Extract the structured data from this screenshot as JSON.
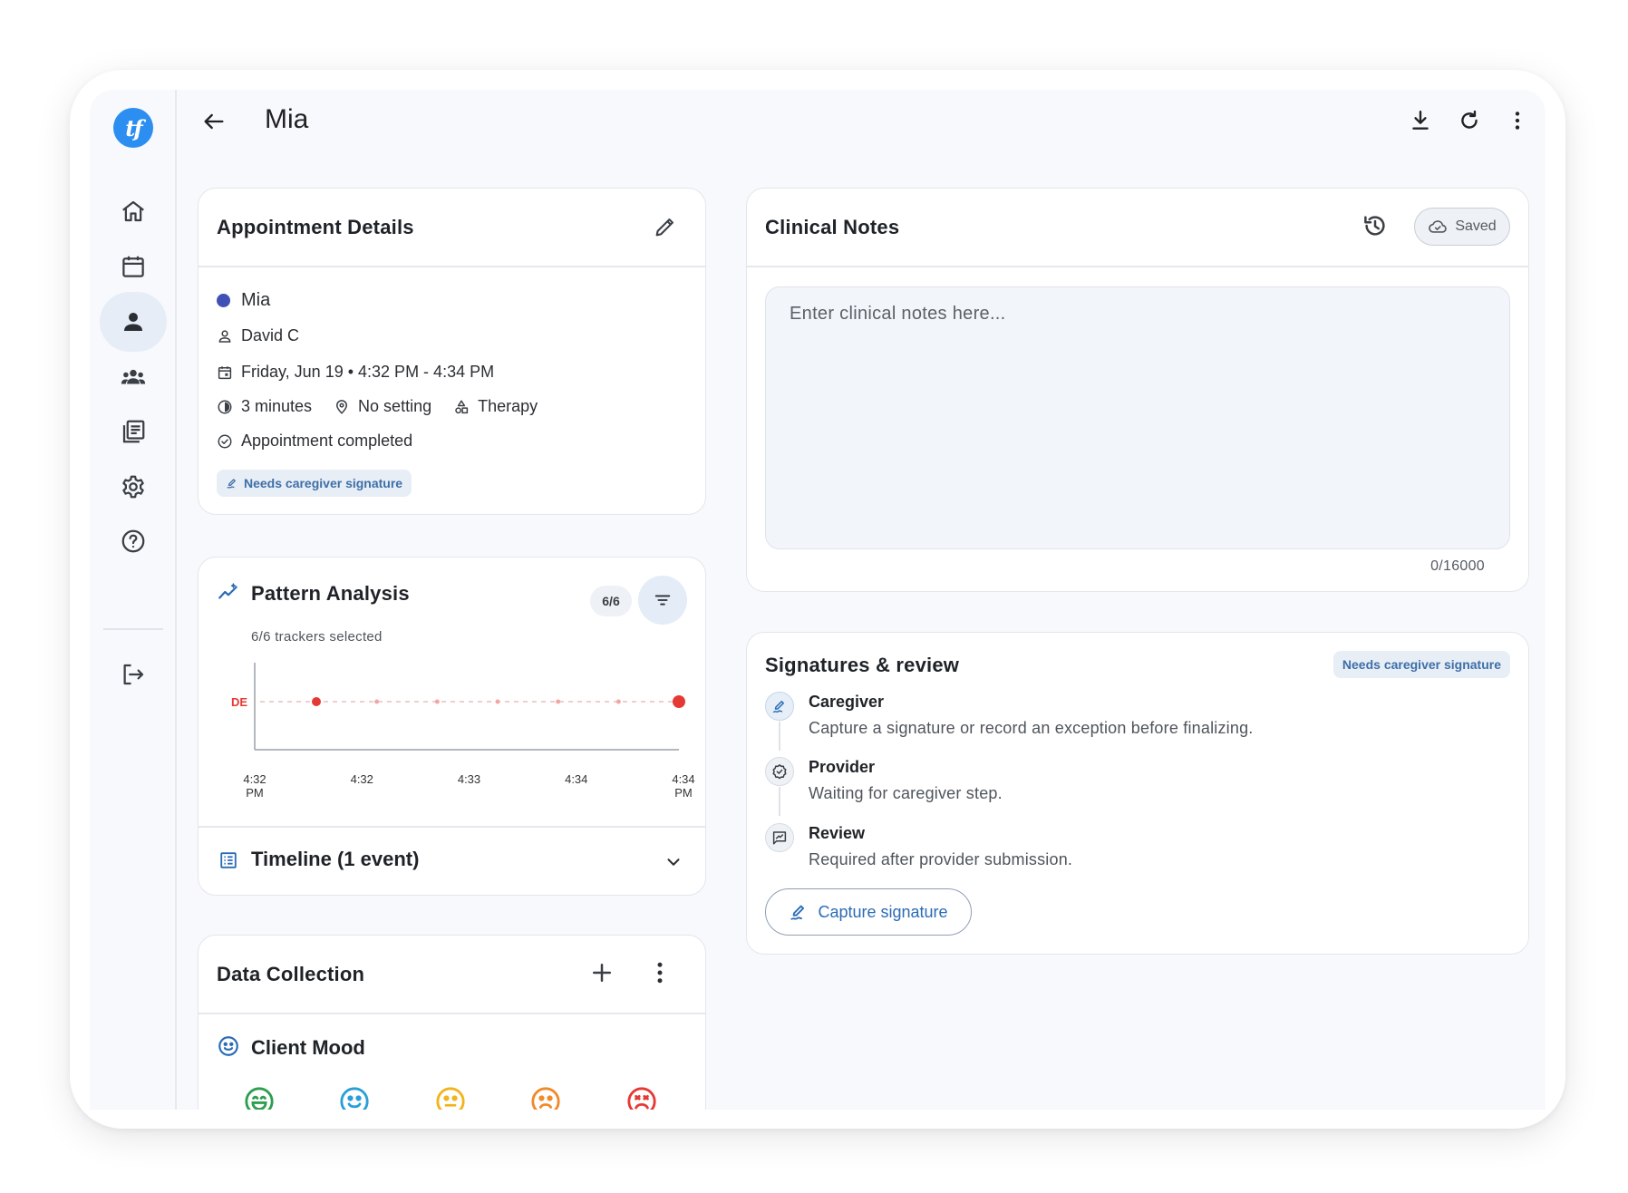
{
  "app": {
    "logo_text": "tf"
  },
  "header": {
    "title": "Mia"
  },
  "sidebar": {
    "items": [
      {
        "name": "home",
        "icon": "home-icon"
      },
      {
        "name": "calendar",
        "icon": "calendar-icon"
      },
      {
        "name": "clients",
        "icon": "person-icon",
        "active": true
      },
      {
        "name": "groups",
        "icon": "group-icon"
      },
      {
        "name": "library",
        "icon": "library-icon"
      },
      {
        "name": "settings",
        "icon": "gear-icon"
      },
      {
        "name": "help",
        "icon": "help-icon"
      },
      {
        "name": "logout",
        "icon": "logout-icon"
      }
    ]
  },
  "appointment": {
    "title": "Appointment Details",
    "client_name": "Mia",
    "client_color": "#3f51b5",
    "provider": "David C",
    "datetime": "Friday, Jun 19 • 4:32 PM - 4:34 PM",
    "duration": "3 minutes",
    "setting": "No setting",
    "service": "Therapy",
    "status": "Appointment completed",
    "chip": "Needs caregiver signature"
  },
  "pattern": {
    "title": "Pattern Analysis",
    "count_badge": "6/6",
    "subtitle": "6/6 trackers selected",
    "timeline_title": "Timeline (1 event)"
  },
  "chart_data": {
    "type": "scatter",
    "categories": [
      "DE"
    ],
    "x_ticks": [
      "4:32 PM",
      "4:32",
      "4:33",
      "4:34",
      "4:34 PM"
    ],
    "series": [
      {
        "name": "DE",
        "points": [
          "4:32 PM",
          "4:34 PM"
        ]
      }
    ],
    "point_color": "#e53935"
  },
  "data_collection": {
    "title": "Data Collection",
    "mood_title": "Client Mood",
    "moods": [
      {
        "icon": "very-happy-icon",
        "color": "#2e9e4f"
      },
      {
        "icon": "happy-icon",
        "color": "#2a9fd6"
      },
      {
        "icon": "neutral-icon",
        "color": "#f2b41c"
      },
      {
        "icon": "sad-icon",
        "color": "#f08a2a"
      },
      {
        "icon": "very-sad-icon",
        "color": "#e53935"
      }
    ]
  },
  "clinical_notes": {
    "title": "Clinical Notes",
    "saved_label": "Saved",
    "placeholder": "Enter clinical notes here...",
    "counter": "0/16000"
  },
  "signatures": {
    "title": "Signatures & review",
    "chip": "Needs caregiver signature",
    "steps": [
      {
        "title": "Caregiver",
        "desc": "Capture a signature or record an exception before finalizing."
      },
      {
        "title": "Provider",
        "desc": "Waiting for caregiver step."
      },
      {
        "title": "Review",
        "desc": "Required after provider submission."
      }
    ],
    "capture_label": "Capture signature"
  },
  "colors": {
    "accent": "#2a6bb5",
    "logo": "#2c8ef0",
    "active_nav": "#e6edf7"
  }
}
